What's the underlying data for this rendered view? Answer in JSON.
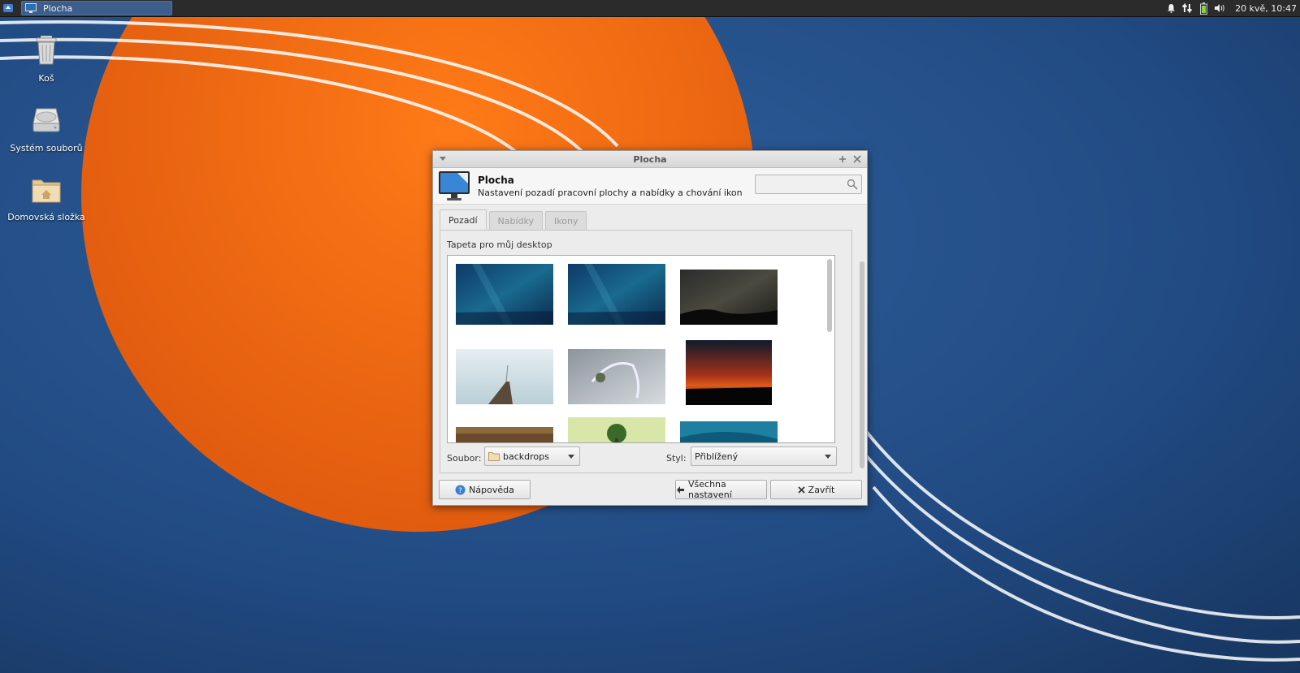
{
  "panel": {
    "task_label": "Plocha",
    "clock": "20 kvě, 10:47"
  },
  "desktop": {
    "icons": [
      {
        "label": "Koš"
      },
      {
        "label": "Systém souborů"
      },
      {
        "label": "Domovská složka"
      }
    ]
  },
  "dialog": {
    "title": "Plocha",
    "header_title": "Plocha",
    "header_subtitle": "Nastavení pozadí pracovní plochy a nabídky a chování ikon",
    "search": {
      "value": "",
      "placeholder": ""
    },
    "tabs": [
      {
        "label": "Pozadí",
        "active": true
      },
      {
        "label": "Nabídky",
        "active": false
      },
      {
        "label": "Ikony",
        "active": false
      }
    ],
    "background": {
      "section_label": "Tapeta pro můj desktop",
      "folder_label": "Soubor:",
      "folder_value": "backdrops",
      "style_label": "Styl:",
      "style_value": "Přiblížený"
    },
    "buttons": {
      "help": "Nápověda",
      "all_settings": "Všechna nastavení",
      "close": "Zavřít"
    }
  },
  "colors": {
    "accent": "#3d5d8b",
    "wallpaper_orange": "#ee6a14",
    "wallpaper_blue": "#1f3f6e"
  }
}
